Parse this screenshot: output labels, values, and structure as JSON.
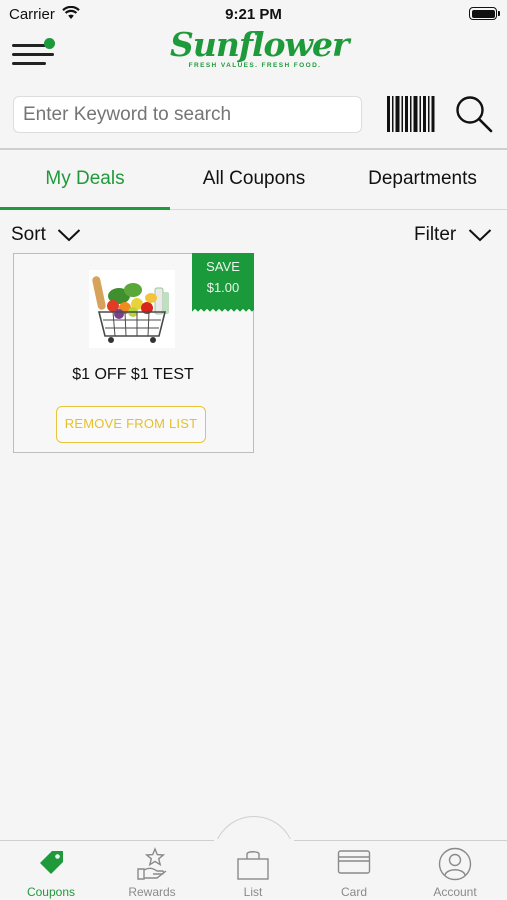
{
  "status_bar": {
    "carrier": "Carrier",
    "time": "9:21 PM",
    "icons": [
      "wifi-icon",
      "battery-icon"
    ]
  },
  "header": {
    "logo_text": "Sunflower",
    "logo_tagline": "FRESH VALUES. FRESH FOOD.",
    "menu_icon": "hamburger-icon",
    "notification_dot_color": "#1a9a3a"
  },
  "search": {
    "placeholder": "Enter Keyword to search",
    "barcode_icon": "barcode-icon",
    "search_icon": "search-icon"
  },
  "tabs": [
    {
      "label": "My Deals",
      "active": true
    },
    {
      "label": "All Coupons",
      "active": false
    },
    {
      "label": "Departments",
      "active": false
    }
  ],
  "toolbar": {
    "sort_label": "Sort",
    "filter_label": "Filter"
  },
  "coupons": [
    {
      "save_label": "SAVE",
      "save_amount": "$1.00",
      "title": "$1 OFF $1 TEST",
      "action_label": "REMOVE FROM LIST",
      "image": "grocery-basket"
    }
  ],
  "bottom_nav": [
    {
      "label": "Coupons",
      "icon": "tag-icon",
      "active": true
    },
    {
      "label": "Rewards",
      "icon": "rewards-hand-star-icon",
      "active": false
    },
    {
      "label": "List",
      "icon": "basket-list-icon",
      "active": false
    },
    {
      "label": "Card",
      "icon": "card-icon",
      "active": false
    },
    {
      "label": "Account",
      "icon": "account-icon",
      "active": false
    }
  ],
  "colors": {
    "brand_green": "#1f9a3a",
    "button_yellow": "#e6c02a",
    "background": "#f5f5f5"
  }
}
